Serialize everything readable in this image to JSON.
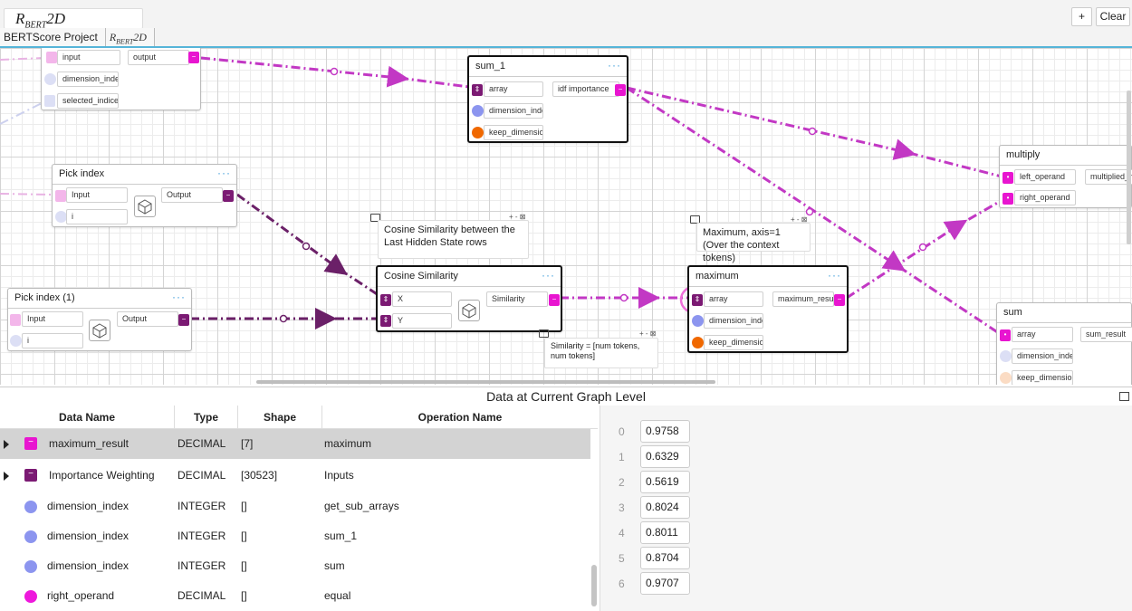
{
  "header": {
    "graph_name": "R_BERT2D",
    "add_label": "+",
    "clear_label": "Clear",
    "breadcrumb": [
      "BERTScore Project",
      "R_BERT2D"
    ]
  },
  "canvas": {
    "nodes": {
      "top_left": {
        "ports": [
          "input",
          "dimension_inde",
          "selected_indice"
        ],
        "output": "output"
      },
      "sum_1": {
        "title": "sum_1",
        "menu": "···",
        "ports": [
          "array",
          "dimension_inde",
          "keep_dimensior"
        ],
        "output": "idf importance"
      },
      "pick_index": {
        "title": "Pick index",
        "menu": "···",
        "ports": [
          "Input",
          "i"
        ],
        "output": "Output"
      },
      "pick_index_1": {
        "title": "Pick index (1)",
        "menu": "···",
        "ports": [
          "Input",
          "i"
        ],
        "output": "Output"
      },
      "cosine": {
        "title": "Cosine Similarity",
        "menu": "···",
        "ports": [
          "X",
          "Y"
        ],
        "output": "Similarity"
      },
      "maximum": {
        "title": "maximum",
        "menu": "···",
        "ports": [
          "array",
          "dimension_inde",
          "keep_dimensior"
        ],
        "output": "maximum_resul"
      },
      "multiply": {
        "title": "multiply",
        "ports": [
          "left_operand",
          "right_operand"
        ],
        "output": "multiplied_r"
      },
      "sum": {
        "title": "sum",
        "ports": [
          "array",
          "dimension_inde",
          "keep_dimensior"
        ],
        "output": "sum_result"
      }
    },
    "comments": {
      "cosine_note": "Cosine Similarity between the Last Hidden State rows",
      "maximum_note": "Maximum, axis=1 (Over the context tokens)",
      "similarity_note": "Similarity = [num tokens, num tokens]"
    },
    "comment_tools": "+ - ⊠",
    "colors": {
      "wire_pink": "#c238c4",
      "wire_purple": "#6b2068",
      "selection_ring": "#ee6fd9",
      "accent": "#55b4d8"
    }
  },
  "panel": {
    "title": "Data at Current Graph Level",
    "columns": [
      "Data Name",
      "Type",
      "Shape",
      "Operation Name"
    ],
    "rows": [
      {
        "name": "maximum_result",
        "type": "DECIMAL",
        "shape": "[7]",
        "op": "maximum",
        "icon": "pink-square"
      },
      {
        "name": "Importance Weighting",
        "type": "DECIMAL",
        "shape": "[30523]",
        "op": "Inputs",
        "icon": "purple-square"
      },
      {
        "name": "dimension_index",
        "type": "INTEGER",
        "shape": "[]",
        "op": "get_sub_arrays",
        "icon": "blue-dot"
      },
      {
        "name": "dimension_index",
        "type": "INTEGER",
        "shape": "[]",
        "op": "sum_1",
        "icon": "blue-dot"
      },
      {
        "name": "dimension_index",
        "type": "INTEGER",
        "shape": "[]",
        "op": "sum",
        "icon": "blue-dot"
      },
      {
        "name": "right_operand",
        "type": "DECIMAL",
        "shape": "[]",
        "op": "equal",
        "icon": "magenta-dot"
      }
    ],
    "values": [
      {
        "index": "0",
        "value": "0.9758"
      },
      {
        "index": "1",
        "value": "0.6329"
      },
      {
        "index": "2",
        "value": "0.5619"
      },
      {
        "index": "3",
        "value": "0.8024"
      },
      {
        "index": "4",
        "value": "0.8011"
      },
      {
        "index": "5",
        "value": "0.8704"
      },
      {
        "index": "6",
        "value": "0.9707"
      }
    ]
  }
}
